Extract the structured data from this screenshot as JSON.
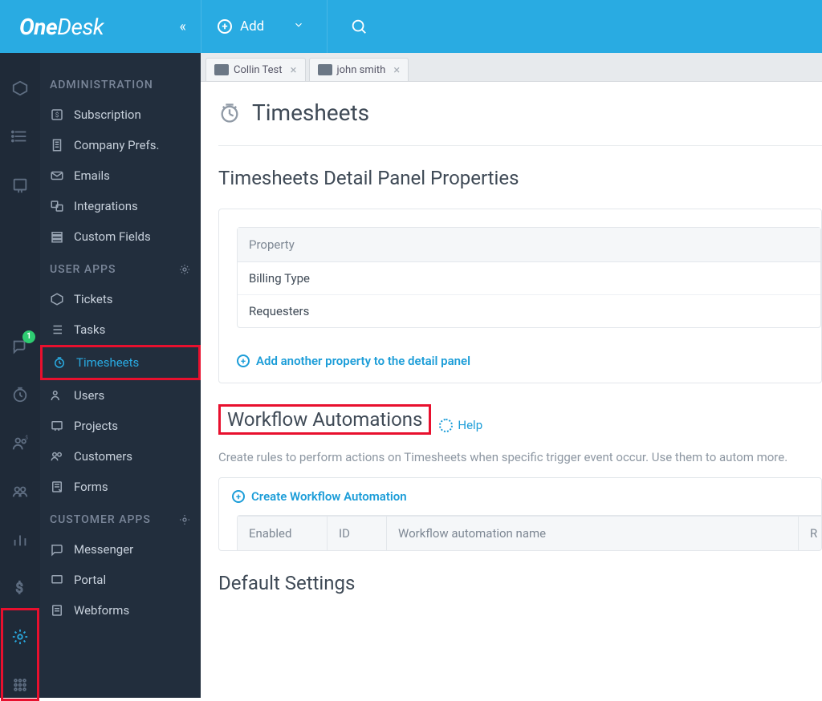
{
  "header": {
    "logo_bold": "One",
    "logo_thin": "Desk",
    "add_label": "Add"
  },
  "rail": {
    "badge": "1"
  },
  "sidebar": {
    "section_admin": "ADMINISTRATION",
    "admin_items": [
      {
        "label": "Subscription",
        "icon": "dollar"
      },
      {
        "label": "Company Prefs.",
        "icon": "building"
      },
      {
        "label": "Emails",
        "icon": "mail"
      },
      {
        "label": "Integrations",
        "icon": "link"
      },
      {
        "label": "Custom Fields",
        "icon": "fields"
      }
    ],
    "section_user": "USER APPS",
    "user_items": [
      {
        "label": "Tickets",
        "icon": "ticket"
      },
      {
        "label": "Tasks",
        "icon": "tasks"
      },
      {
        "label": "Timesheets",
        "icon": "clock",
        "selected": true
      },
      {
        "label": "Users",
        "icon": "users"
      },
      {
        "label": "Projects",
        "icon": "projects"
      },
      {
        "label": "Customers",
        "icon": "customers"
      },
      {
        "label": "Forms",
        "icon": "form"
      }
    ],
    "section_customer": "CUSTOMER APPS",
    "customer_items": [
      {
        "label": "Messenger",
        "icon": "chat"
      },
      {
        "label": "Portal",
        "icon": "portal"
      },
      {
        "label": "Webforms",
        "icon": "webform"
      }
    ]
  },
  "tabs": [
    {
      "label": "Collin Test"
    },
    {
      "label": "john smith"
    }
  ],
  "page": {
    "title": "Timesheets",
    "panel_section_title": "Timesheets Detail Panel Properties",
    "property_header": "Property",
    "properties": [
      "Billing Type",
      "Requesters"
    ],
    "add_property": "Add another property to the detail panel",
    "wf_title": "Workflow Automations",
    "wf_help": "Help",
    "wf_desc": "Create rules to perform actions on Timesheets when specific trigger event occur. Use them to autom more.",
    "wf_create": "Create Workflow Automation",
    "wf_cols": {
      "enabled": "Enabled",
      "id": "ID",
      "name": "Workflow automation name",
      "r": "R"
    },
    "default_settings": "Default Settings"
  }
}
